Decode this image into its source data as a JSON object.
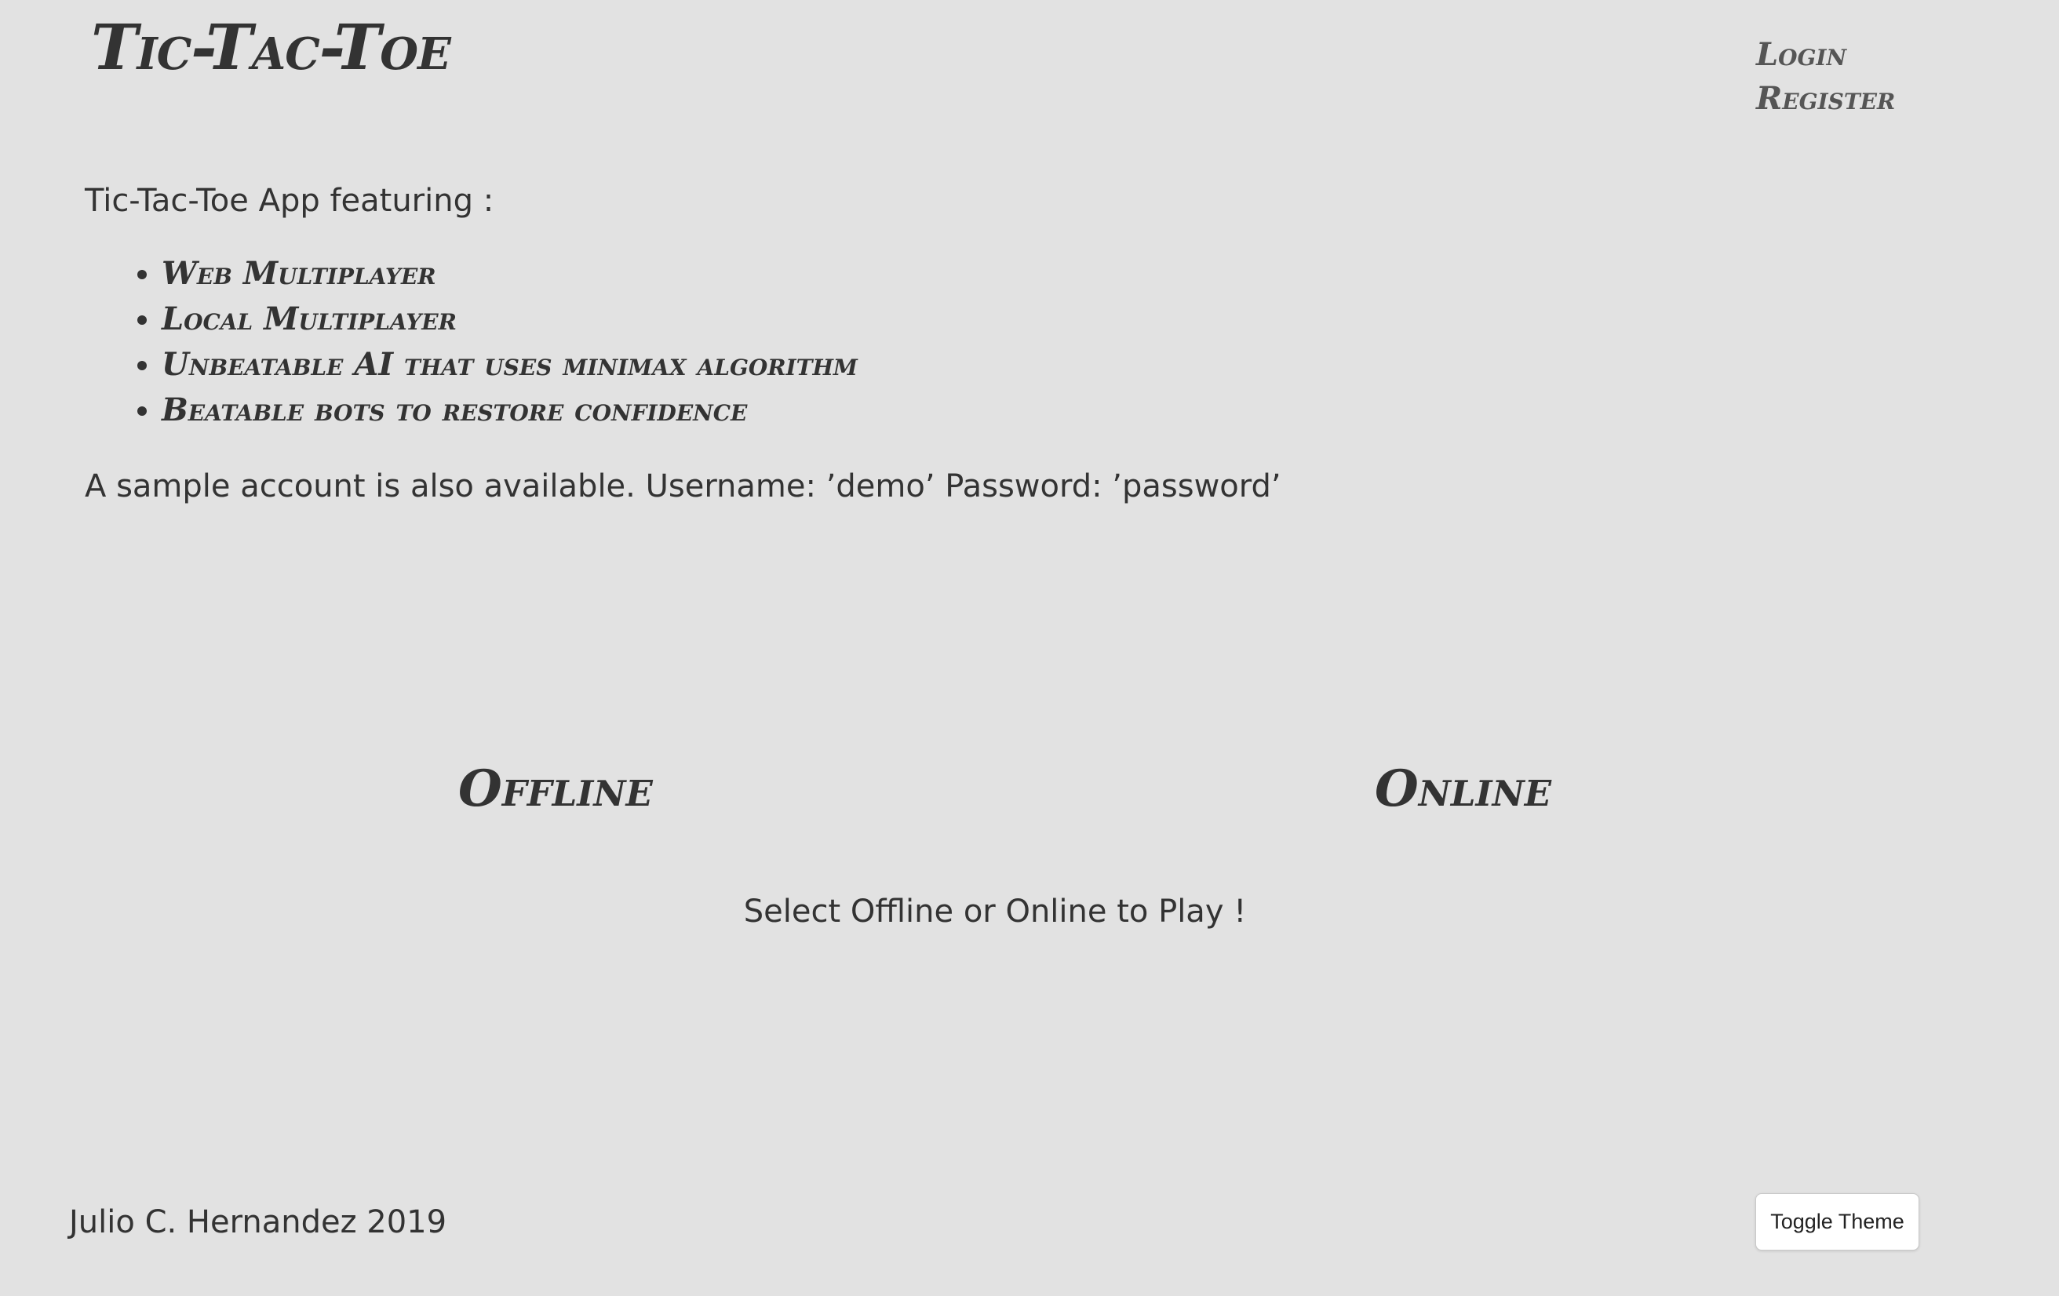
{
  "header": {
    "title": "Tic-Tac-Toe",
    "nav": [
      {
        "label": "Login"
      },
      {
        "label": "Register"
      }
    ]
  },
  "intro": {
    "text": "Tic-Tac-Toe App featuring :",
    "features": [
      "Web Multiplayer",
      "Local Multiplayer",
      "Unbeatable AI that uses minimax algorithm",
      "Beatable bots to restore confidence"
    ],
    "demo_note": "A sample account is also available. Username: ’demo’ Password: ’password’"
  },
  "modes": {
    "offline": "Offline",
    "online": "Online",
    "prompt": "Select Offline or Online to Play !"
  },
  "footer": {
    "credit": "Julio C. Hernandez 2019",
    "toggle_theme_label": "Toggle Theme"
  },
  "colors": {
    "background": "#e2e2e2",
    "text": "#333333",
    "button_bg": "#ffffff"
  }
}
